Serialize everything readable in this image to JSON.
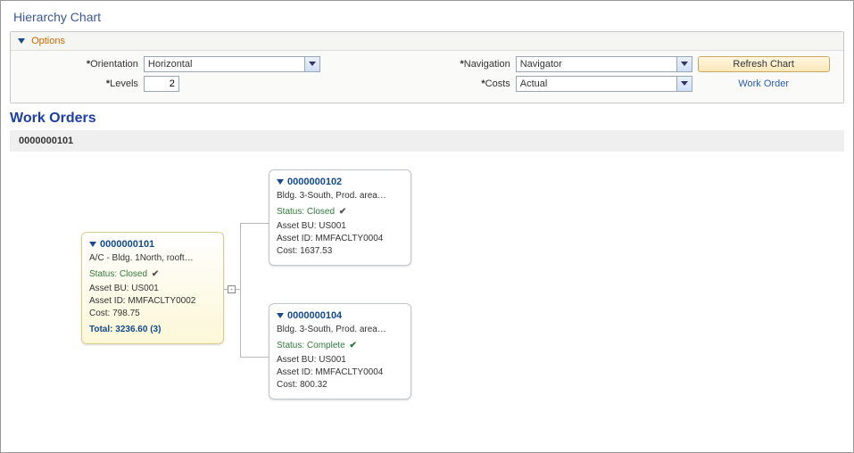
{
  "page_title": "Hierarchy Chart",
  "options": {
    "header": "Options",
    "orientation_label": "Orientation",
    "orientation_value": "Horizontal",
    "levels_label": "Levels",
    "levels_value": "2",
    "navigation_label": "Navigation",
    "navigation_value": "Navigator",
    "costs_label": "Costs",
    "costs_value": "Actual",
    "refresh_label": "Refresh Chart",
    "work_order_link": "Work Order"
  },
  "section_title": "Work Orders",
  "root_id_bar": "0000000101",
  "nodes": {
    "root": {
      "id": "0000000101",
      "desc": "A/C - Bldg. 1North, rooft…",
      "status_label": "Status:",
      "status_value": "Closed",
      "asset_bu_label": "Asset BU:",
      "asset_bu_value": "US001",
      "asset_id_label": "Asset ID:",
      "asset_id_value": "MMFACLTY0002",
      "cost_label": "Cost:",
      "cost_value": "798.75",
      "total_label": "Total:",
      "total_value": "3236.60 (3)"
    },
    "child1": {
      "id": "0000000102",
      "desc": "Bldg. 3-South, Prod. area…",
      "status_label": "Status:",
      "status_value": "Closed",
      "asset_bu_label": "Asset BU:",
      "asset_bu_value": "US001",
      "asset_id_label": "Asset ID:",
      "asset_id_value": "MMFACLTY0004",
      "cost_label": "Cost:",
      "cost_value": "1637.53"
    },
    "child2": {
      "id": "0000000104",
      "desc": "Bldg. 3-South, Prod. area…",
      "status_label": "Status:",
      "status_value": "Complete",
      "asset_bu_label": "Asset BU:",
      "asset_bu_value": "US001",
      "asset_id_label": "Asset ID:",
      "asset_id_value": "MMFACLTY0004",
      "cost_label": "Cost:",
      "cost_value": "800.32"
    }
  },
  "chart_data": {
    "type": "tree",
    "orientation": "Horizontal",
    "levels": 2,
    "cost_type": "Actual",
    "root": {
      "id": "0000000101",
      "desc": "A/C - Bldg. 1North, rooft…",
      "status": "Closed",
      "asset_bu": "US001",
      "asset_id": "MMFACLTY0002",
      "cost": 798.75,
      "total_cost": 3236.6,
      "total_count": 3,
      "children": [
        {
          "id": "0000000102",
          "desc": "Bldg. 3-South, Prod. area…",
          "status": "Closed",
          "asset_bu": "US001",
          "asset_id": "MMFACLTY0004",
          "cost": 1637.53
        },
        {
          "id": "0000000104",
          "desc": "Bldg. 3-South, Prod. area…",
          "status": "Complete",
          "asset_bu": "US001",
          "asset_id": "MMFACLTY0004",
          "cost": 800.32
        }
      ]
    }
  }
}
